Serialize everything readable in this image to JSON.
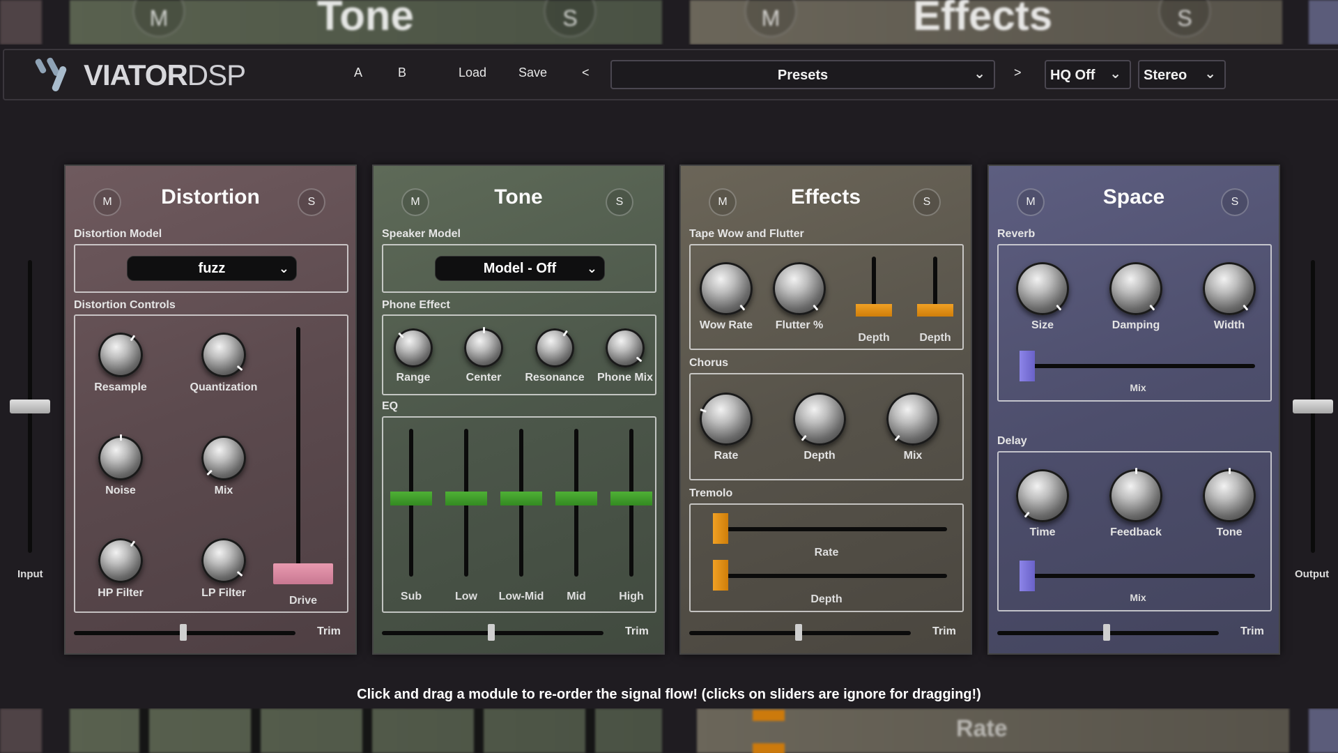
{
  "header": {
    "logo_bold": "VIATOR",
    "logo_light": "DSP",
    "btn_a": "A",
    "btn_b": "B",
    "load": "Load",
    "save": "Save",
    "prev": "<",
    "next": ">",
    "presets": "Presets",
    "hq": "HQ Off",
    "stereo": "Stereo"
  },
  "background": {
    "top_titles": [
      "Tone",
      "Effects"
    ],
    "m": "M",
    "s": "S",
    "bottom_label": "Rate"
  },
  "io": {
    "input": "Input",
    "output": "Output",
    "input_level": 0.5,
    "output_level": 0.5
  },
  "modules": {
    "m": "M",
    "s": "S",
    "trim": "Trim",
    "distortion": {
      "title": "Distortion",
      "model_label": "Distortion Model",
      "model_value": "fuzz",
      "controls_label": "Distortion Controls",
      "knobs": [
        "Resample",
        "Quantization",
        "Noise",
        "Mix",
        "HP Filter",
        "LP Filter"
      ],
      "drive": "Drive"
    },
    "tone": {
      "title": "Tone",
      "model_label": "Speaker Model",
      "model_value": "Model - Off",
      "phone_label": "Phone Effect",
      "phone_knobs": [
        "Range",
        "Center",
        "Resonance",
        "Phone Mix"
      ],
      "eq_label": "EQ",
      "eq_bands": [
        "Sub",
        "Low",
        "Low-Mid",
        "Mid",
        "High"
      ]
    },
    "effects": {
      "title": "Effects",
      "tape_label": "Tape Wow and Flutter",
      "tape_knobs": [
        "Wow Rate",
        "Flutter %"
      ],
      "tape_sliders": [
        "Depth",
        "Depth"
      ],
      "chorus_label": "Chorus",
      "chorus_knobs": [
        "Rate",
        "Depth",
        "Mix"
      ],
      "tremolo_label": "Tremolo",
      "tremolo_sliders": [
        "Rate",
        "Depth"
      ]
    },
    "space": {
      "title": "Space",
      "reverb_label": "Reverb",
      "reverb_knobs": [
        "Size",
        "Damping",
        "Width"
      ],
      "reverb_mix": "Mix",
      "delay_label": "Delay",
      "delay_knobs": [
        "Time",
        "Feedback",
        "Tone"
      ],
      "delay_mix": "Mix"
    }
  },
  "colors": {
    "effects_accent": "#e8920f",
    "tone_accent": "#3f9a2a",
    "space_accent": "#7a72d6",
    "drive_accent": "#d9849c"
  },
  "footer": {
    "note": "Click and drag a module to re-order the signal flow! (clicks on sliders are ignore for dragging!)"
  }
}
